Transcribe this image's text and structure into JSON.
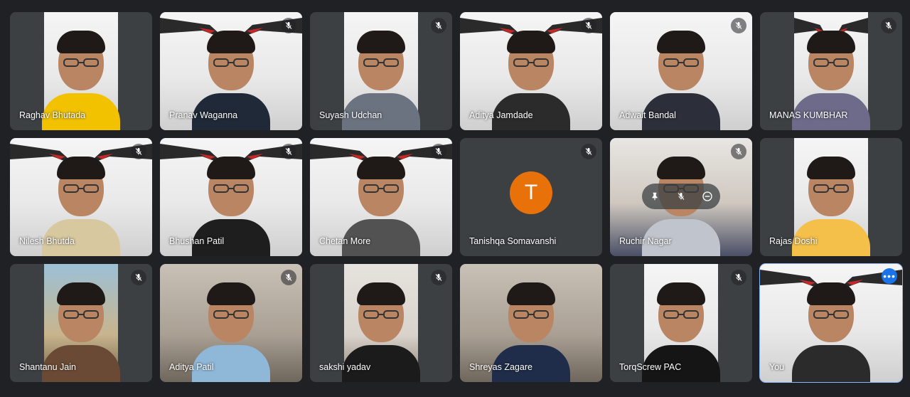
{
  "meeting": {
    "participants": [
      {
        "name": "Raghav Bhutada",
        "muted": false,
        "video": "narrow-white",
        "shirt": "#f2c200"
      },
      {
        "name": "Pranav Waganna",
        "muted": true,
        "video": "wings",
        "shirt": "#1f2937"
      },
      {
        "name": "Suyash Udchan",
        "muted": true,
        "video": "narrow-white",
        "shirt": "#6b7280"
      },
      {
        "name": "Aditya Jamdade",
        "muted": true,
        "video": "wings",
        "shirt": "#2b2b2b"
      },
      {
        "name": "Adwait Bandal",
        "muted": true,
        "video": "white",
        "shirt": "#2c2f3a"
      },
      {
        "name": "MANAS KUMBHAR",
        "muted": true,
        "video": "narrow-wings",
        "shirt": "#6d6a8a"
      },
      {
        "name": "Nilesh Bhutda",
        "muted": true,
        "video": "wings",
        "shirt": "#d8c8a0"
      },
      {
        "name": "Bhushan Patil",
        "muted": true,
        "video": "wings",
        "shirt": "#1e1e1e"
      },
      {
        "name": "Chetan More",
        "muted": true,
        "video": "wings",
        "shirt": "#525252"
      },
      {
        "name": "Tanishqa Somavanshi",
        "muted": true,
        "video": "avatar",
        "avatar_letter": "T"
      },
      {
        "name": "Ruchir Nagar",
        "muted": true,
        "video": "office",
        "shirt": "#c0c4cc",
        "hover_controls": true
      },
      {
        "name": "Rajas Doshi",
        "muted": false,
        "video": "narrow-white",
        "shirt": "#f5c04a"
      },
      {
        "name": "Shantanu Jain",
        "muted": true,
        "video": "narrow-blue",
        "shirt": "#6b4a35"
      },
      {
        "name": "Aditya Patil",
        "muted": true,
        "video": "room",
        "shirt": "#8fb7d8"
      },
      {
        "name": "sakshi yadav",
        "muted": true,
        "video": "narrow-wall",
        "shirt": "#1b1b1b"
      },
      {
        "name": "Shreyas Zagare",
        "muted": false,
        "video": "room",
        "shirt": "#1f2d4a"
      },
      {
        "name": "TorqScrew PAC",
        "muted": true,
        "video": "narrow-white",
        "shirt": "#151515"
      },
      {
        "name": "You",
        "muted": false,
        "video": "wings",
        "shirt": "#2b2b2b",
        "self": true
      }
    ]
  },
  "colors": {
    "background": "#202124",
    "tile": "#3c4043",
    "avatar": "#e8710a",
    "self_outline": "#8ab4f8",
    "more_button": "#1a73e8"
  },
  "icons": {
    "mic": "mic-off-icon",
    "more": "more-options-icon",
    "pin": "pin-icon",
    "remove": "remove-icon"
  }
}
